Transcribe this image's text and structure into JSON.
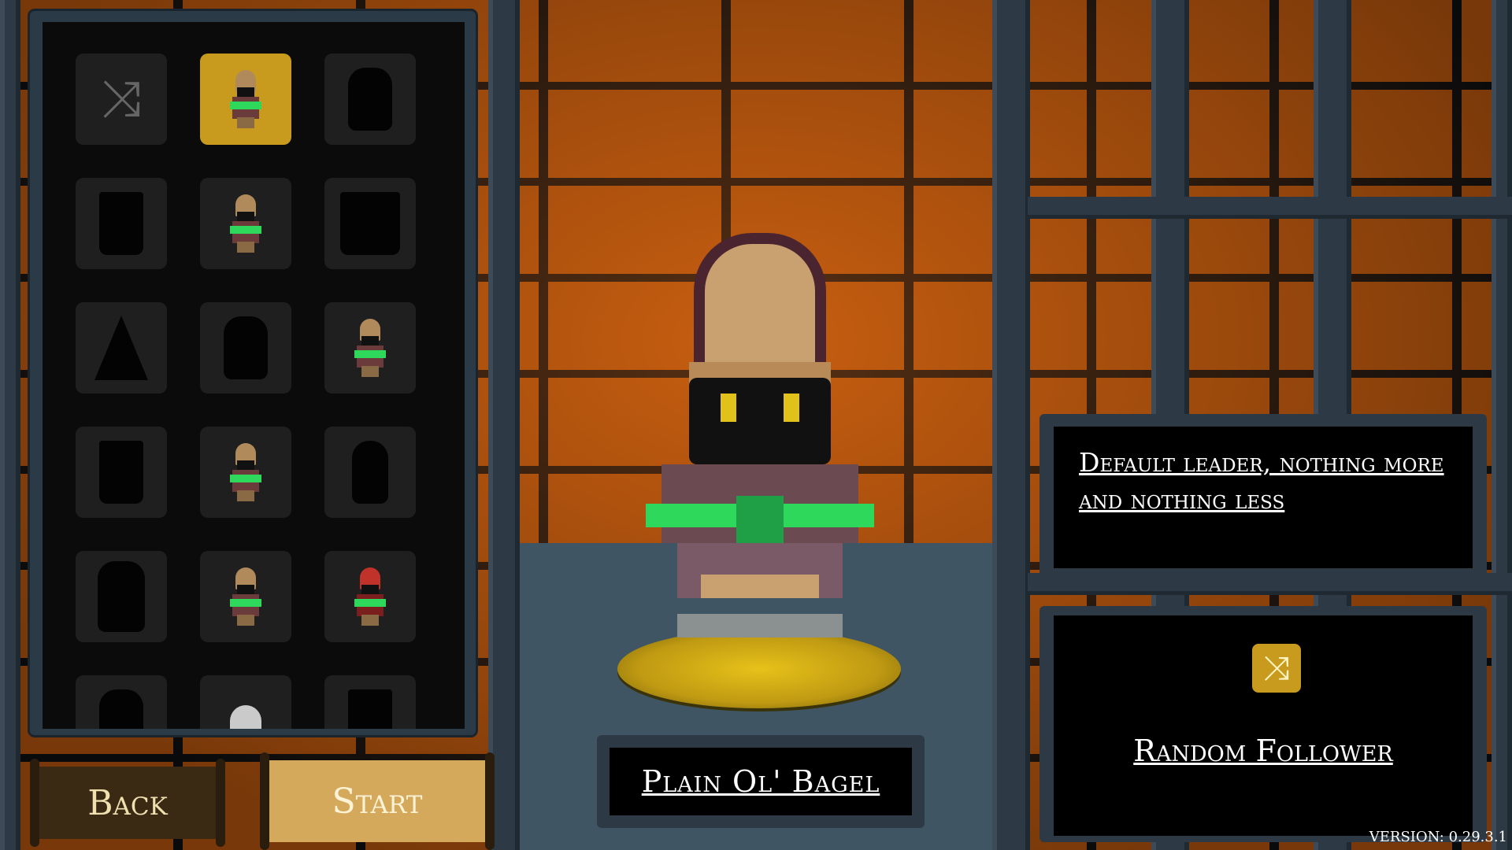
{
  "roster": {
    "slots": [
      {
        "kind": "shuffle",
        "icon": "shuffle-icon"
      },
      {
        "kind": "hero",
        "selected": true
      },
      {
        "kind": "locked"
      },
      {
        "kind": "locked"
      },
      {
        "kind": "hero"
      },
      {
        "kind": "locked"
      },
      {
        "kind": "locked"
      },
      {
        "kind": "locked"
      },
      {
        "kind": "hero"
      },
      {
        "kind": "locked"
      },
      {
        "kind": "hero"
      },
      {
        "kind": "locked"
      },
      {
        "kind": "locked"
      },
      {
        "kind": "hero"
      },
      {
        "kind": "hero-red"
      }
    ]
  },
  "character": {
    "name": "Plain Ol' Bagel",
    "description": "Default leader, nothing more and nothing less"
  },
  "follower": {
    "label": "Random Follower",
    "icon": "shuffle-icon"
  },
  "buttons": {
    "back": "Back",
    "start": "Start"
  },
  "version": "VERSION: 0.29.3.1",
  "colors": {
    "accent": "#c89b1e",
    "brick": "#b8560e",
    "frame": "#2d3a45"
  }
}
